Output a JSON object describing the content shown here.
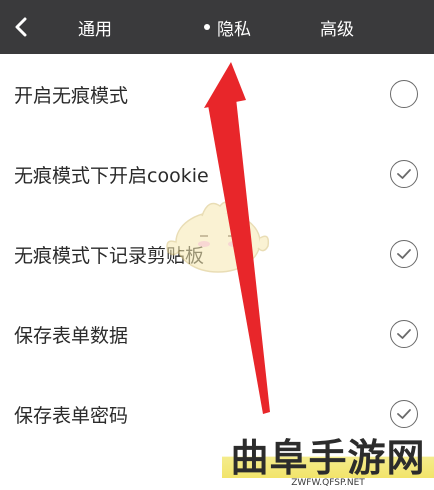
{
  "topbar": {
    "tabs": [
      {
        "label": "通用"
      },
      {
        "label": "隐私"
      },
      {
        "label": "高级"
      }
    ],
    "active_tab_index": 1
  },
  "settings": [
    {
      "label": "开启无痕模式",
      "checked": false
    },
    {
      "label": "无痕模式下开启cookie",
      "checked": true
    },
    {
      "label": "无痕模式下记录剪贴板",
      "checked": true
    },
    {
      "label": "保存表单数据",
      "checked": true
    },
    {
      "label": "保存表单密码",
      "checked": true
    }
  ],
  "watermark": {
    "title": "曲阜手游网",
    "url": "ZWFW.QFSP.NET"
  },
  "colors": {
    "topbar_bg": "#3a3a3c",
    "arrow": "#e8262a",
    "watermark_band": "#f2e46a"
  }
}
